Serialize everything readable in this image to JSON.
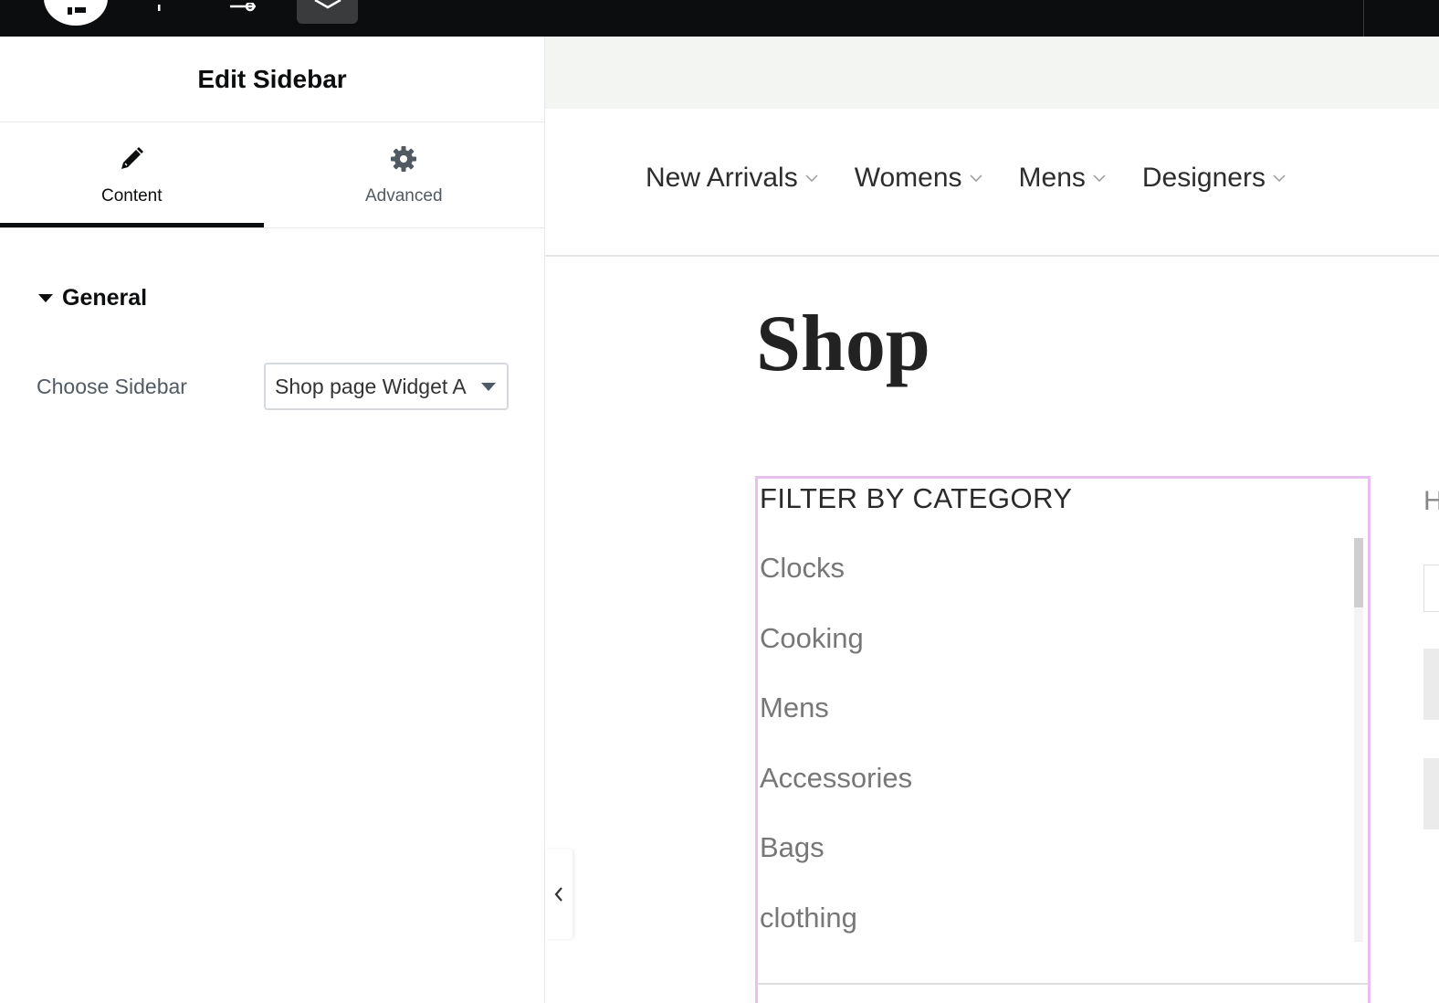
{
  "topbar": {
    "icons": [
      "elementor-logo-icon",
      "plus-icon",
      "sliders-icon",
      "layers-icon"
    ]
  },
  "panel": {
    "title": "Edit Sidebar",
    "tabs": [
      {
        "label": "Content",
        "icon": "pencil-icon",
        "active": true
      },
      {
        "label": "Advanced",
        "icon": "gear-icon",
        "active": false
      }
    ],
    "section": {
      "title": "General"
    },
    "control": {
      "label": "Choose Sidebar",
      "value": "Shop page Widget A"
    }
  },
  "preview": {
    "nav": [
      {
        "label": "New Arrivals"
      },
      {
        "label": "Womens"
      },
      {
        "label": "Mens"
      },
      {
        "label": "Designers"
      }
    ],
    "page_title": "Shop",
    "widget": {
      "title": "FILTER BY CATEGORY",
      "categories": [
        "Clocks",
        "Cooking",
        "Mens",
        "Accessories",
        "Bags",
        "clothing"
      ]
    },
    "side_hint_text": "H"
  },
  "colors": {
    "topbar_bg": "#0c0d0e",
    "widget_outline": "#e7bff2",
    "preview_band": "#f2f5f2"
  }
}
